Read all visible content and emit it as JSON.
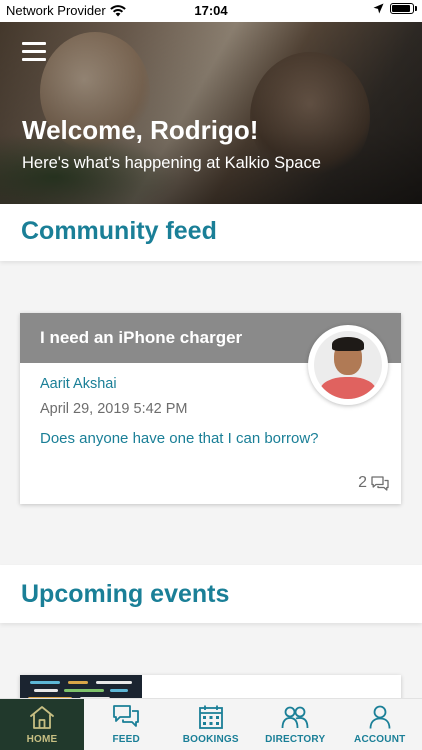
{
  "status_bar": {
    "carrier": "Network Provider",
    "time": "17:04",
    "battery_level": 0.9
  },
  "hero": {
    "title": "Welcome, Rodrigo!",
    "subtitle": "Here's what's happening at Kalkio Space"
  },
  "feed": {
    "heading": "Community feed",
    "post": {
      "title": "I need an iPhone charger",
      "author": "Aarit Akshai",
      "date": "April 29, 2019 5:42 PM",
      "body": "Does anyone have one that I can borrow?",
      "comment_count": "2"
    }
  },
  "events": {
    "heading": "Upcoming events"
  },
  "tab_bar": {
    "active": "home",
    "tabs": [
      {
        "id": "home",
        "label": "HOME",
        "icon": "home-icon"
      },
      {
        "id": "feed",
        "label": "FEED",
        "icon": "chat-bubbles-icon"
      },
      {
        "id": "bookings",
        "label": "BOOKINGS",
        "icon": "calendar-icon"
      },
      {
        "id": "directory",
        "label": "DIRECTORY",
        "icon": "people-icon"
      },
      {
        "id": "account",
        "label": "ACCOUNT",
        "icon": "user-icon"
      }
    ]
  },
  "colors": {
    "accent": "#1a7f97",
    "tab_active_bg": "#21392c",
    "tab_active_label": "#c7bf83",
    "post_title_bar": "#8a8a8a"
  }
}
